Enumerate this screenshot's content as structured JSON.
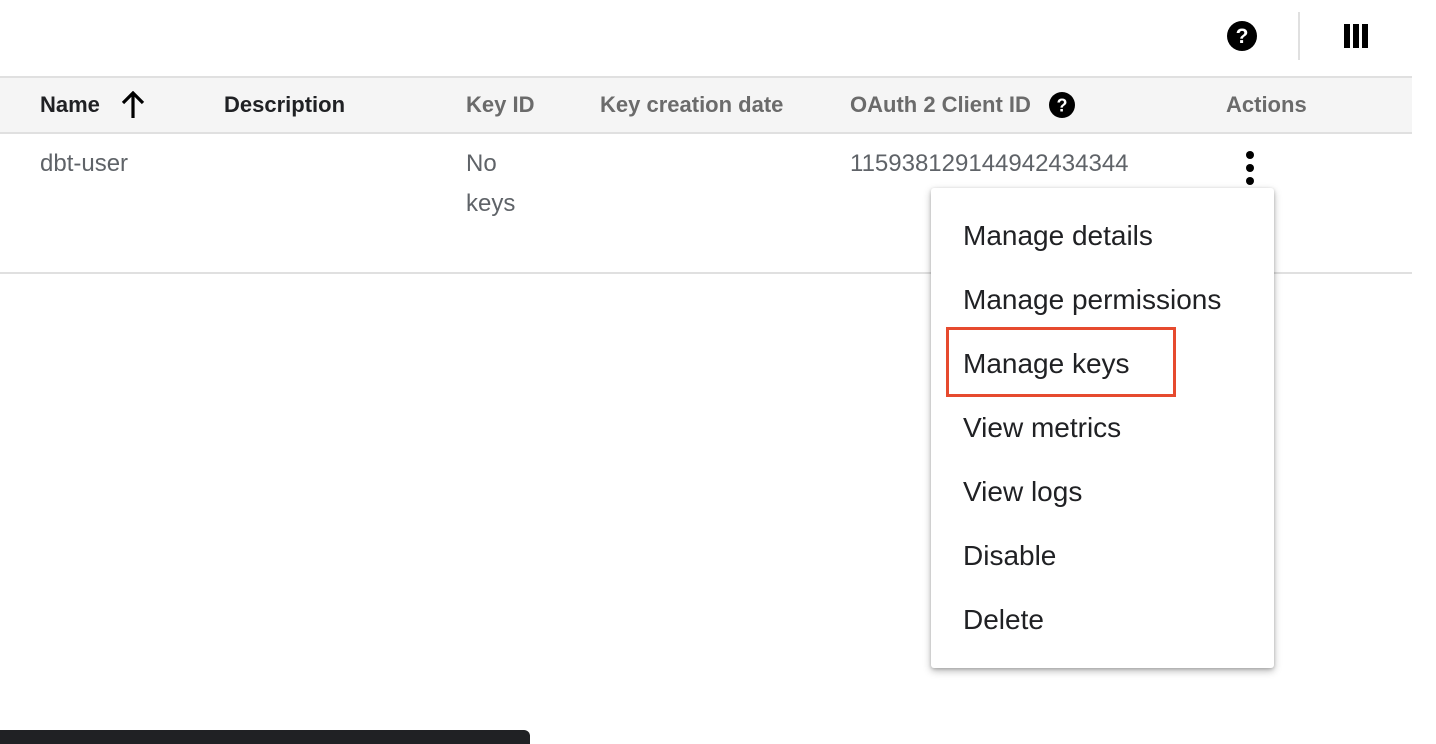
{
  "toolbar": {
    "help_icon": "help-circle-icon",
    "columns_icon": "view-column-icon"
  },
  "table": {
    "headers": {
      "name": "Name",
      "description": "Description",
      "key_id": "Key ID",
      "key_creation_date": "Key creation date",
      "oauth_client_id": "OAuth 2 Client ID",
      "actions": "Actions"
    },
    "sort": {
      "column": "Name",
      "direction": "ascending",
      "icon": "arrow-up-icon"
    },
    "rows": [
      {
        "name": "dbt-user",
        "description": "",
        "key_id": "No keys",
        "key_creation_date": "",
        "oauth_client_id": "115938129144942434344",
        "actions_icon": "more-vert-icon"
      }
    ]
  },
  "menu": {
    "items": [
      "Manage details",
      "Manage permissions",
      "Manage keys",
      "View metrics",
      "View logs",
      "Disable",
      "Delete"
    ],
    "highlighted": "Manage keys"
  },
  "colors": {
    "highlight": "#e64a2e",
    "header_bg": "#f5f5f5",
    "muted_text": "#5f6368"
  }
}
